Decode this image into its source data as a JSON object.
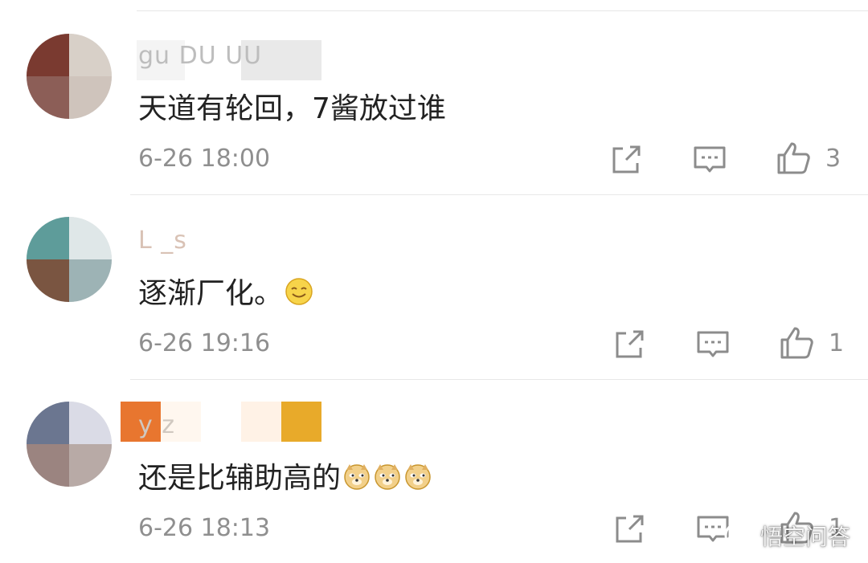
{
  "comments": [
    {
      "username": "gu  DU   UU",
      "text": "天道有轮回，7酱放过谁",
      "time": "6-26 18:00",
      "likes": "3"
    },
    {
      "username": "L  _s",
      "text": "逐渐厂化。",
      "emoji": "smile-emoji",
      "time": "6-26 19:16",
      "likes": "1"
    },
    {
      "username": "y  z",
      "text": "还是比辅助高的",
      "emoji": "doge-emoji",
      "time": "6-26 18:13",
      "likes": "1"
    }
  ],
  "icons": {
    "share": "share-icon",
    "reply": "comment-icon",
    "like": "thumbs-up-icon"
  },
  "watermark": {
    "text": "悟空问答"
  },
  "colors": {
    "text": "#222222",
    "meta": "#8f8f8f",
    "divider": "#e8e8e8"
  }
}
